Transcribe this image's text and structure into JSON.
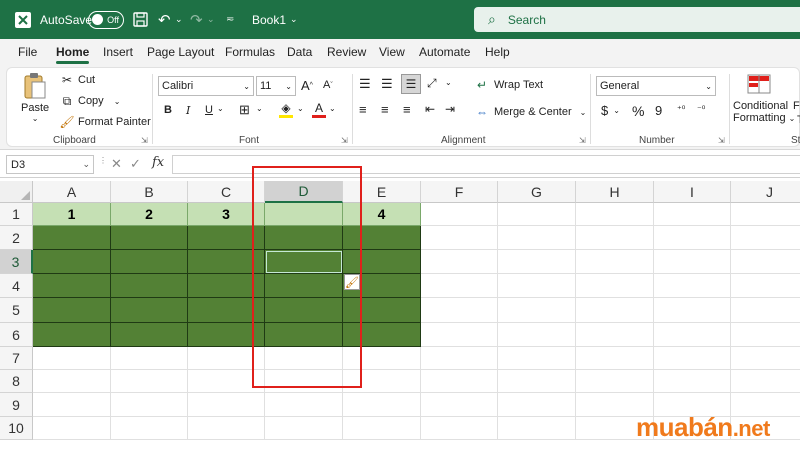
{
  "titlebar": {
    "autosave_label": "AutoSave",
    "autosave_state": "Off",
    "book_title": "Book1",
    "search_placeholder": "Search"
  },
  "tabs": [
    "File",
    "Home",
    "Insert",
    "Page Layout",
    "Formulas",
    "Data",
    "Review",
    "View",
    "Automate",
    "Help"
  ],
  "active_tab": "Home",
  "ribbon": {
    "clipboard": {
      "paste": "Paste",
      "cut": "Cut",
      "copy": "Copy",
      "format_painter": "Format Painter",
      "label": "Clipboard"
    },
    "font": {
      "name": "Calibri",
      "size": "11",
      "label": "Font",
      "bold": "B",
      "italic": "I",
      "underline": "U",
      "font_color_letter": "A"
    },
    "alignment": {
      "wrap": "Wrap Text",
      "merge": "Merge & Center",
      "label": "Alignment"
    },
    "number": {
      "format": "General",
      "label": "Number",
      "currency": "$",
      "percent": "%",
      "comma": "9"
    },
    "styles": {
      "conditional": "Conditional",
      "formatting": "Formatting",
      "fo": "Fo",
      "t": "T",
      "label": "Sty"
    }
  },
  "formula_bar": {
    "name_box": "D3",
    "fx": "fx",
    "value": ""
  },
  "columns": [
    "A",
    "B",
    "C",
    "D",
    "E",
    "F",
    "G",
    "H",
    "I",
    "J"
  ],
  "rows": [
    "1",
    "2",
    "3",
    "4",
    "5",
    "6",
    "7",
    "8",
    "9",
    "10"
  ],
  "selected_column": "D",
  "selected_row": "3",
  "cells": {
    "A1": "1",
    "B1": "2",
    "C1": "3",
    "D1": "",
    "E1": "4"
  },
  "colors": {
    "header_fill": "#c5e0b4",
    "body_fill": "#538135",
    "excel_green": "#1e7145",
    "highlight_red": "#e0201b"
  },
  "watermark": {
    "main": "muabán",
    "tld": ".net"
  }
}
